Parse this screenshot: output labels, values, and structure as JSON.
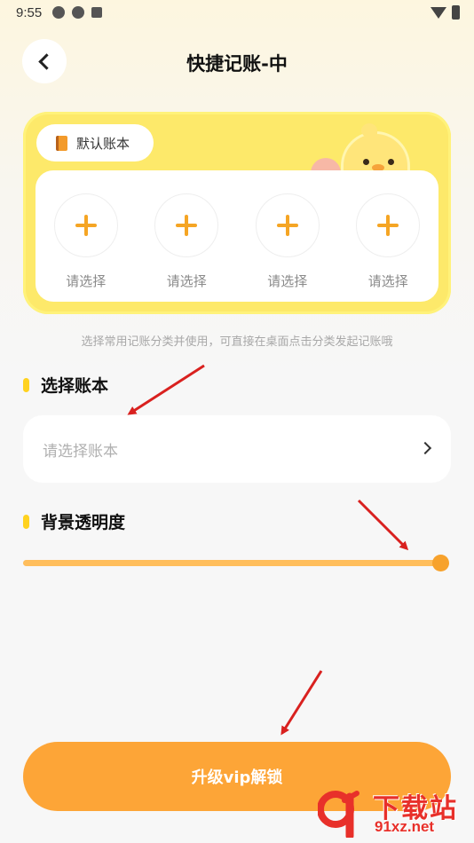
{
  "status_bar": {
    "time": "9:55",
    "icons": [
      "app-icon",
      "app-icon",
      "a-icon",
      "wifi-icon",
      "battery-icon"
    ]
  },
  "header": {
    "title": "快捷记账-中",
    "back_icon": "chevron-left-icon"
  },
  "widget_preview": {
    "book_tab_label": "默认账本",
    "book_icon": "book-icon",
    "slots": [
      {
        "label": "请选择",
        "icon": "plus-icon"
      },
      {
        "label": "请选择",
        "icon": "plus-icon"
      },
      {
        "label": "请选择",
        "icon": "plus-icon"
      },
      {
        "label": "请选择",
        "icon": "plus-icon"
      }
    ]
  },
  "hint": "选择常用记账分类并使用，可直接在桌面点击分类发起记账哦",
  "account_section": {
    "label": "选择账本",
    "placeholder": "请选择账本"
  },
  "opacity_section": {
    "label": "背景透明度",
    "value_fraction": 1.0
  },
  "vip_button": {
    "label": "升级vip解锁"
  },
  "colors": {
    "accent": "#fda537",
    "card_yellow": "#fde96a",
    "marker_yellow": "#ffd21f",
    "annotation_arrow": "#d9211f"
  },
  "watermark": {
    "title": "下载站",
    "url": "91xz.net"
  }
}
